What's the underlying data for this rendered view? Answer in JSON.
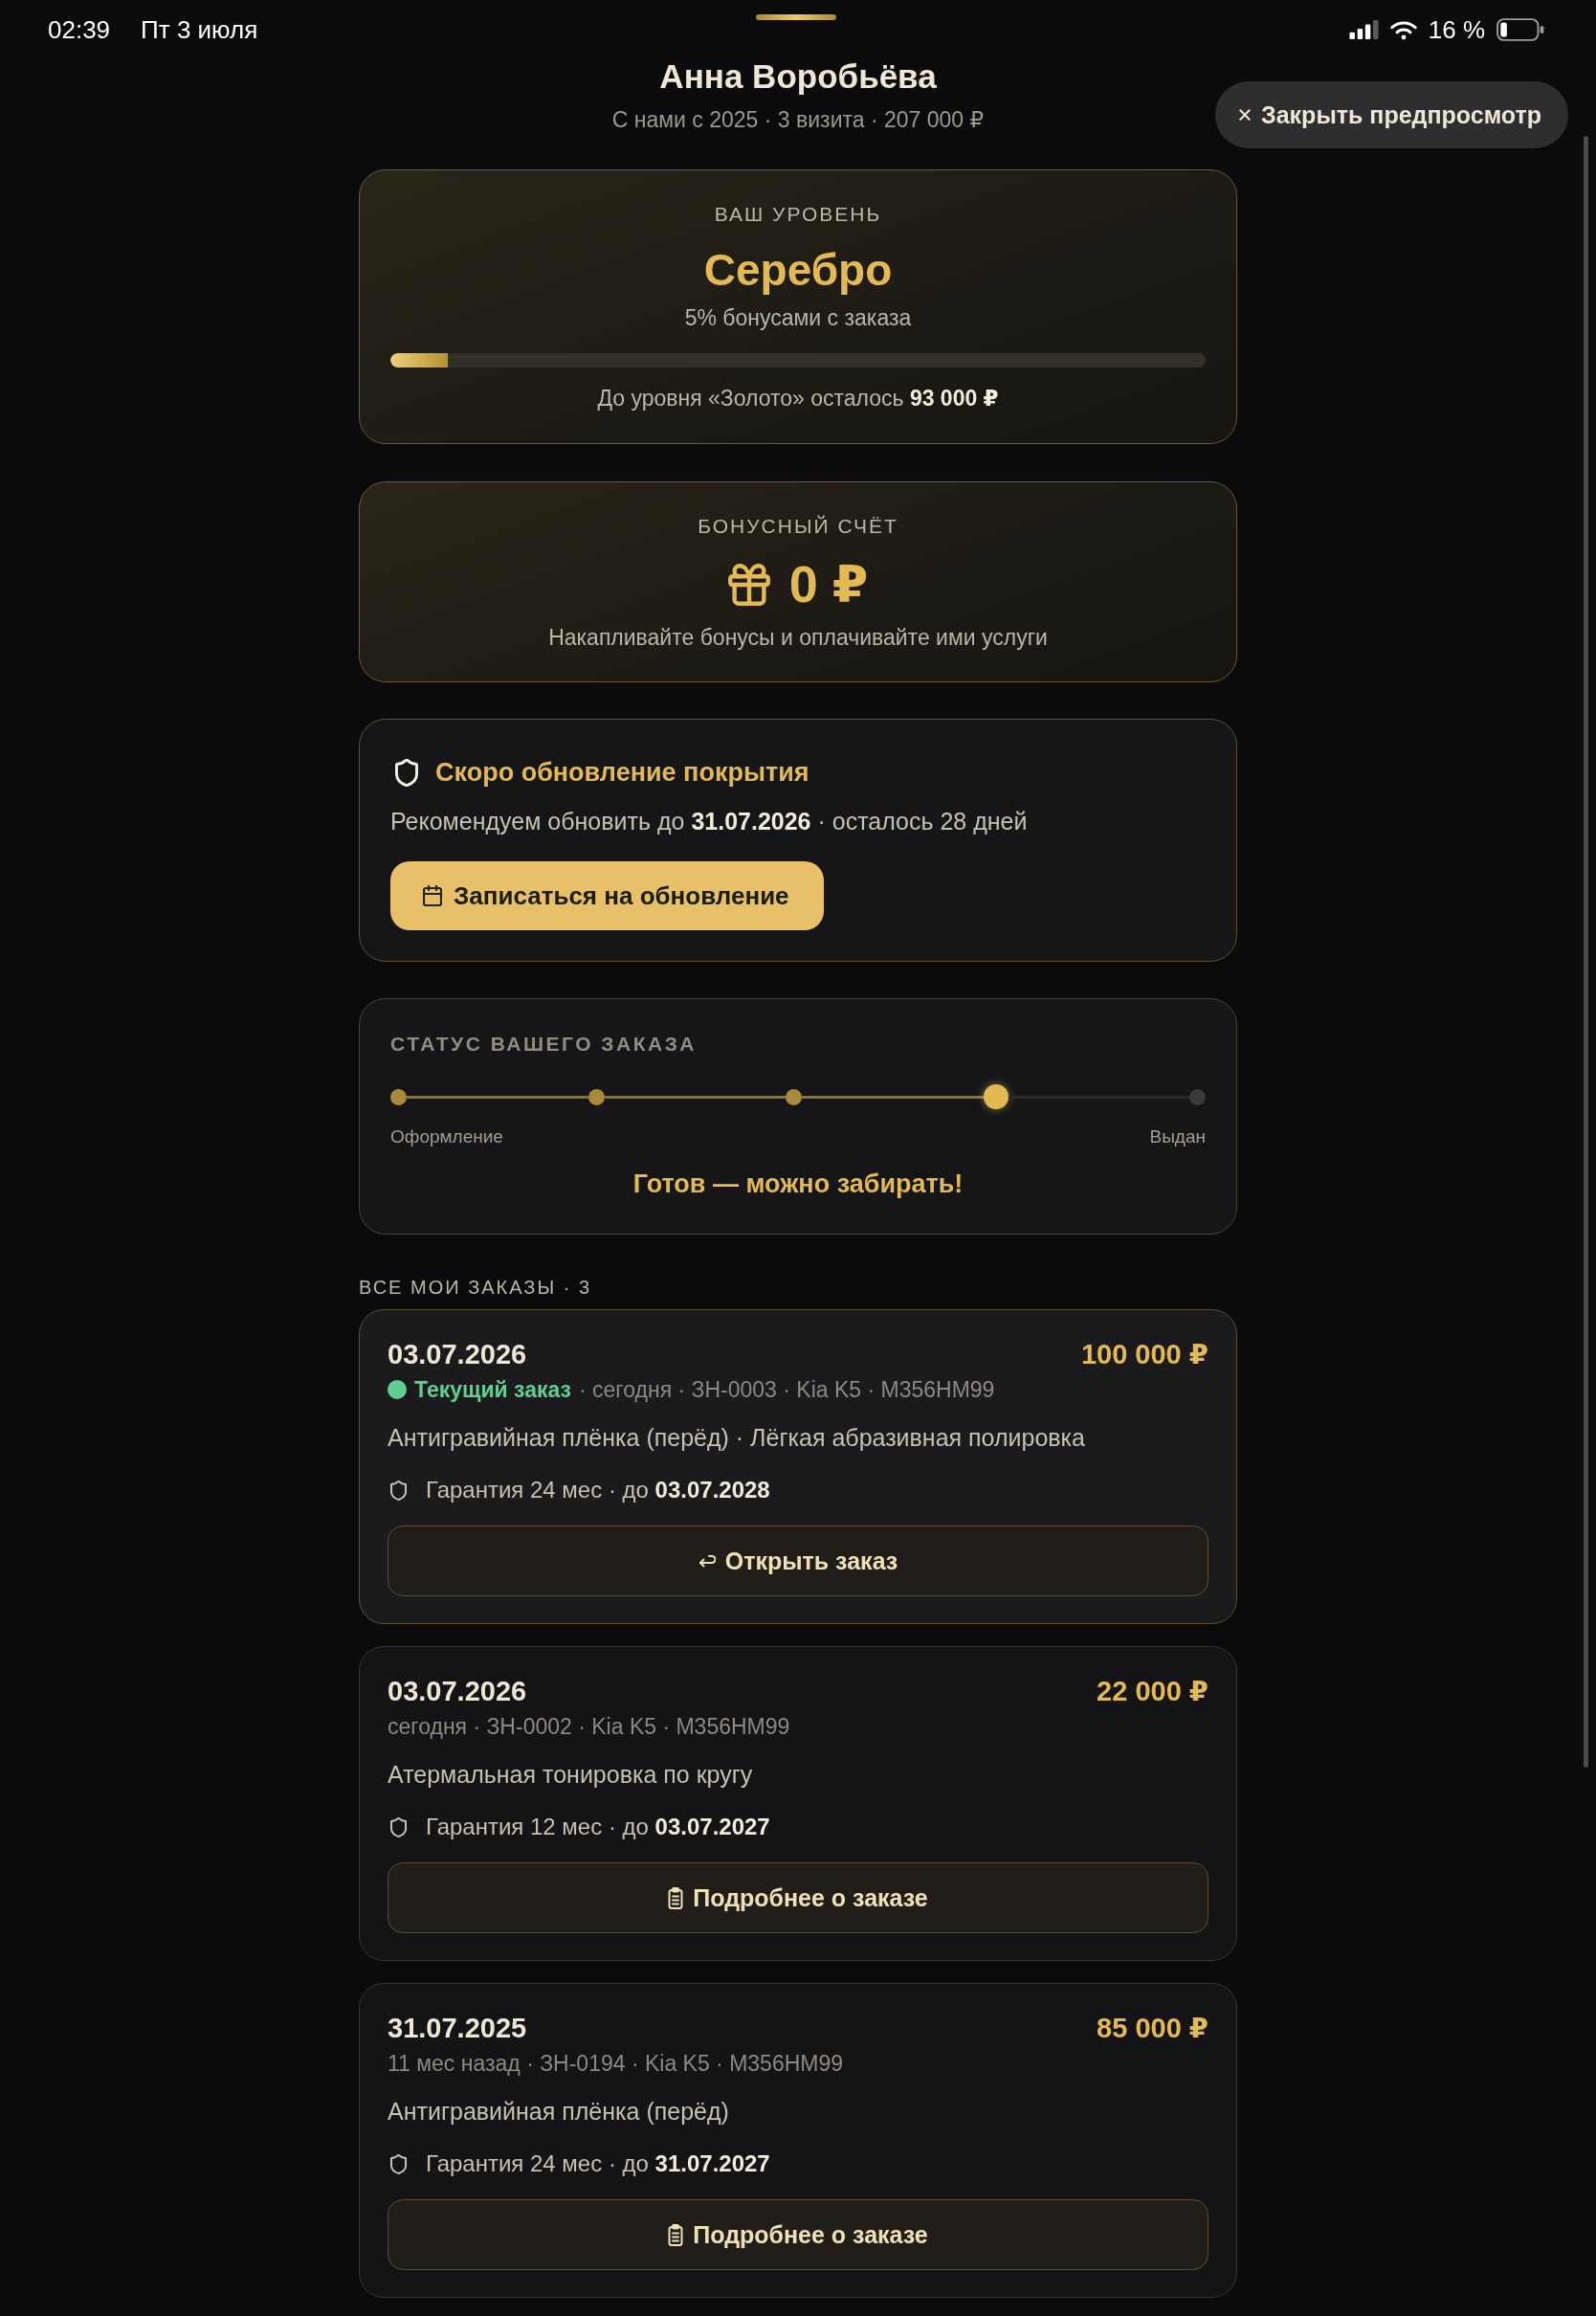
{
  "status_bar": {
    "time": "02:39",
    "date": "Пт 3 июля",
    "battery": "16 %"
  },
  "close_preview": {
    "label": "Закрыть предпросмотр"
  },
  "profile": {
    "name": "Анна Воробьёва",
    "summary": "С нами с 2025 · 3 визита · 207 000 ₽"
  },
  "level_card": {
    "label": "ВАШ УРОВЕНЬ",
    "tier": "Серебро",
    "bonus_rate": "5% бонусами с заказа",
    "progress": {
      "level": 0.07
    },
    "remaining": "До уровня «Золото» осталось **93 000 ₽**"
  },
  "bonus_card": {
    "label": "БОНУСНЫЙ СЧЁТ",
    "balance": "0 ₽",
    "hint": "Накапливайте бонусы и оплачивайте ими услуги"
  },
  "coverage_notice": {
    "title": "Скоро обновление покрытия",
    "text": "Рекомендуем обновить до **31.07.2026** · осталось 28 дней",
    "button": "Записаться на обновление"
  },
  "order_status": {
    "title": "СТАТУС ВАШЕГО ЗАКАЗА",
    "steps": [
      {
        "label": "Оформление",
        "done": true,
        "current": false
      },
      {
        "done": true,
        "current": false
      },
      {
        "done": true,
        "current": false
      },
      {
        "done": false,
        "current": true
      },
      {
        "label": "Выдан",
        "done": false,
        "current": false
      }
    ],
    "message": "Готов — можно забирать!"
  },
  "orders": {
    "heading": "ВСЕ МОИ ЗАКАЗЫ · 3",
    "items": [
      {
        "date": "03.07.2026",
        "amount": "100 000 ₽",
        "current": true,
        "badge": "Текущий заказ",
        "meta": "· сегодня · ЗН-0003 · Kia K5 · М356НМ99",
        "services": "Антигравийная плёнка (перёд) · Лёгкая абразивная полировка",
        "warranty": "Гарантия 24 мес · до **03.07.2028**",
        "button": {
          "kind": "open",
          "label": "Открыть заказ"
        }
      },
      {
        "date": "03.07.2026",
        "amount": "22 000 ₽",
        "current": false,
        "meta": "сегодня · ЗН-0002 · Kia K5 · М356НМ99",
        "services": "Атермальная тонировка по кругу",
        "warranty": "Гарантия 12 мес · до **03.07.2027**",
        "button": {
          "kind": "details",
          "label": "Подробнее о заказе"
        }
      },
      {
        "date": "31.07.2025",
        "amount": "85 000 ₽",
        "current": false,
        "meta": "11 мес назад · ЗН-0194 · Kia K5 · М356НМ99",
        "services": "Антигравийная плёнка (перёд)",
        "warranty": "Гарантия 24 мес · до **31.07.2027**",
        "button": {
          "kind": "details",
          "label": "Подробнее о заказе"
        }
      }
    ]
  }
}
